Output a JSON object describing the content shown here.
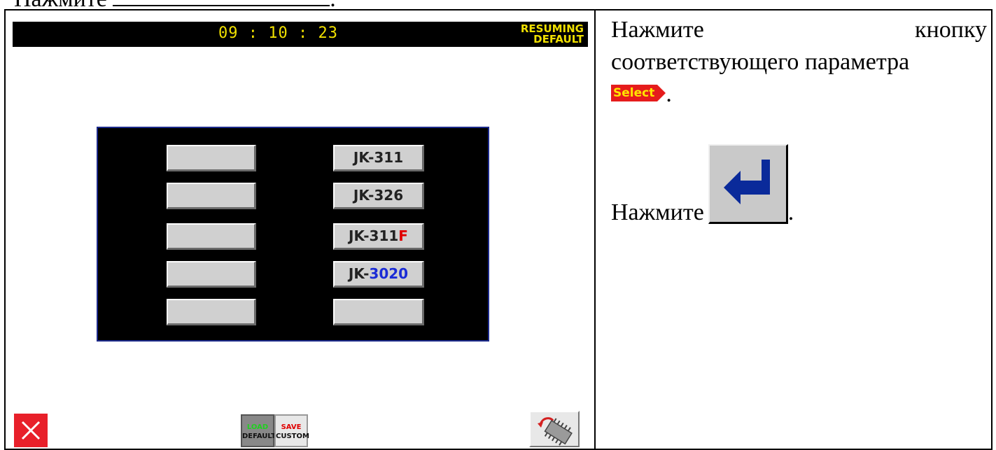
{
  "top_line": {
    "text": "Нажмите",
    "trailing": "."
  },
  "screen": {
    "clock": "09 : 10 : 23",
    "status_line1": "RESUMING",
    "status_line2": "DEFAULT",
    "left_buttons": [
      "",
      "",
      "",
      "",
      ""
    ],
    "right_buttons": [
      {
        "prefix": "JK-311",
        "suffix": "",
        "suffix_color": ""
      },
      {
        "prefix": "JK-326",
        "suffix": "",
        "suffix_color": ""
      },
      {
        "prefix": "JK-311",
        "suffix": "F",
        "suffix_color": "#e00000"
      },
      {
        "prefix": "JK-",
        "suffix": "3020",
        "suffix_color": "#1a2bd6"
      },
      {
        "prefix": "",
        "suffix": "",
        "suffix_color": ""
      }
    ],
    "load_button": {
      "line1": "LOAD",
      "line2": "DEFAULT"
    },
    "save_button": {
      "line1": "SAVE",
      "line2": "CUSTOM"
    },
    "icons": {
      "close": "close-icon",
      "chip": "chip-restore-icon"
    }
  },
  "instructions": {
    "para1_word1": "Нажмите",
    "para1_word2": "кнопку",
    "para1_line2": "соответствующего параметра",
    "select_label": "Select",
    "para1_end": ".",
    "para2_text": "Нажмите",
    "para2_end": ".",
    "enter_icon": "enter-arrow-icon"
  },
  "colors": {
    "screen_text_yellow": "#f0e000",
    "panel_border": "#1c2a8c",
    "close_red": "#e8202a",
    "select_bg": "#e51c1c",
    "select_text": "#ffe600",
    "enter_arrow": "#0a2a9a"
  }
}
